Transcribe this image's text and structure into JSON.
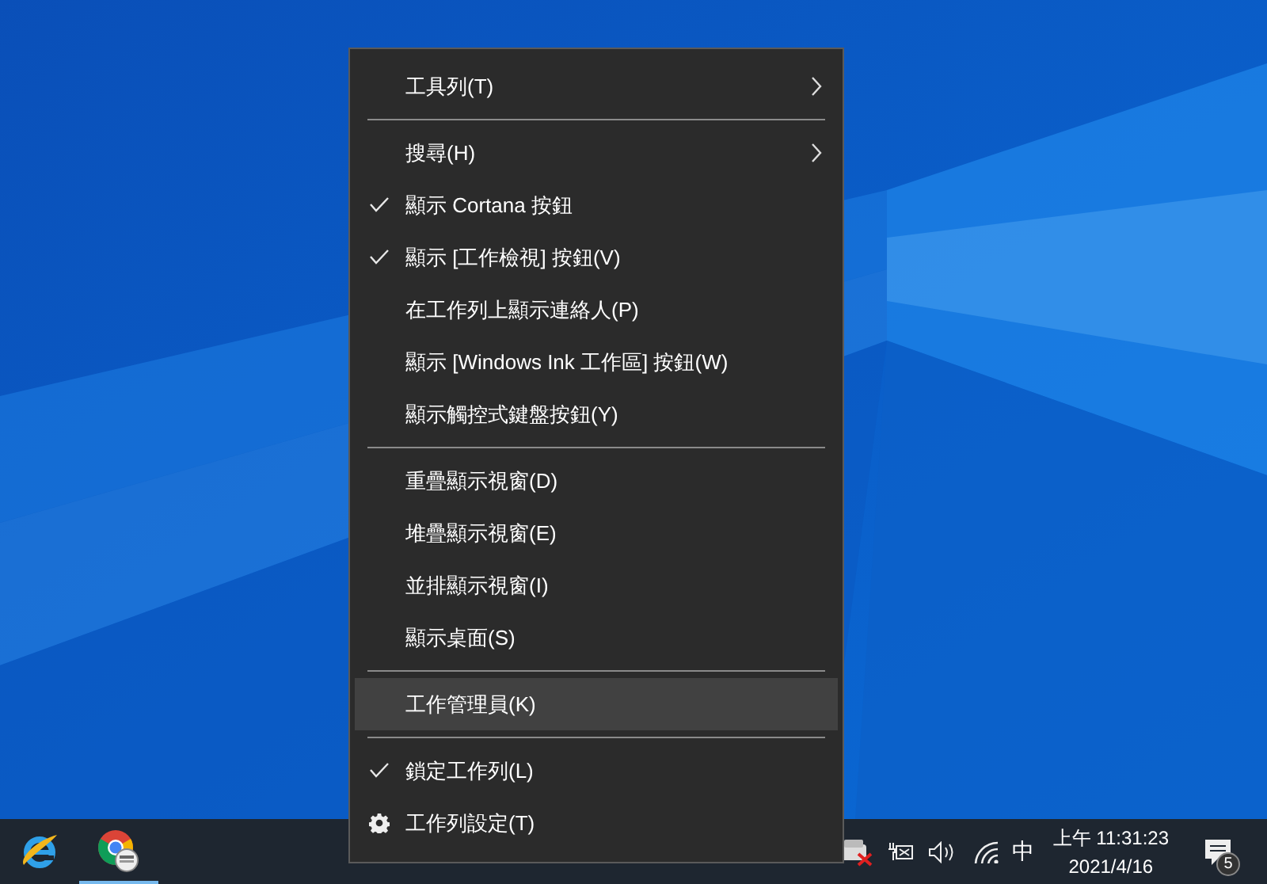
{
  "context_menu": {
    "sections": [
      [
        {
          "label": "工具列(T)",
          "kind": "submenu",
          "checked": false,
          "selected": false
        }
      ],
      [
        {
          "label": "搜尋(H)",
          "kind": "submenu",
          "checked": false,
          "selected": false
        },
        {
          "label": "顯示 Cortana 按鈕",
          "kind": "command",
          "checked": true,
          "selected": false
        },
        {
          "label": "顯示 [工作檢視] 按鈕(V)",
          "kind": "command",
          "checked": true,
          "selected": false
        },
        {
          "label": "在工作列上顯示連絡人(P)",
          "kind": "command",
          "checked": false,
          "selected": false
        },
        {
          "label": "顯示 [Windows Ink 工作區] 按鈕(W)",
          "kind": "command",
          "checked": false,
          "selected": false
        },
        {
          "label": "顯示觸控式鍵盤按鈕(Y)",
          "kind": "command",
          "checked": false,
          "selected": false
        }
      ],
      [
        {
          "label": "重疊顯示視窗(D)",
          "kind": "command",
          "checked": false,
          "selected": false
        },
        {
          "label": "堆疊顯示視窗(E)",
          "kind": "command",
          "checked": false,
          "selected": false
        },
        {
          "label": "並排顯示視窗(I)",
          "kind": "command",
          "checked": false,
          "selected": false
        },
        {
          "label": "顯示桌面(S)",
          "kind": "command",
          "checked": false,
          "selected": false
        }
      ],
      [
        {
          "label": "工作管理員(K)",
          "kind": "command",
          "checked": false,
          "selected": true
        }
      ],
      [
        {
          "label": "鎖定工作列(L)",
          "kind": "command",
          "checked": true,
          "selected": false
        },
        {
          "label": "工作列設定(T)",
          "kind": "settings",
          "checked": false,
          "selected": false
        }
      ]
    ]
  },
  "taskbar": {
    "apps": [
      {
        "kind": "ie",
        "running": false
      },
      {
        "kind": "chrome",
        "running": true
      }
    ],
    "tray": {
      "input_method": "中",
      "time": "上午 11:31:23",
      "date": "2021/4/16",
      "notification_count": "5"
    }
  }
}
